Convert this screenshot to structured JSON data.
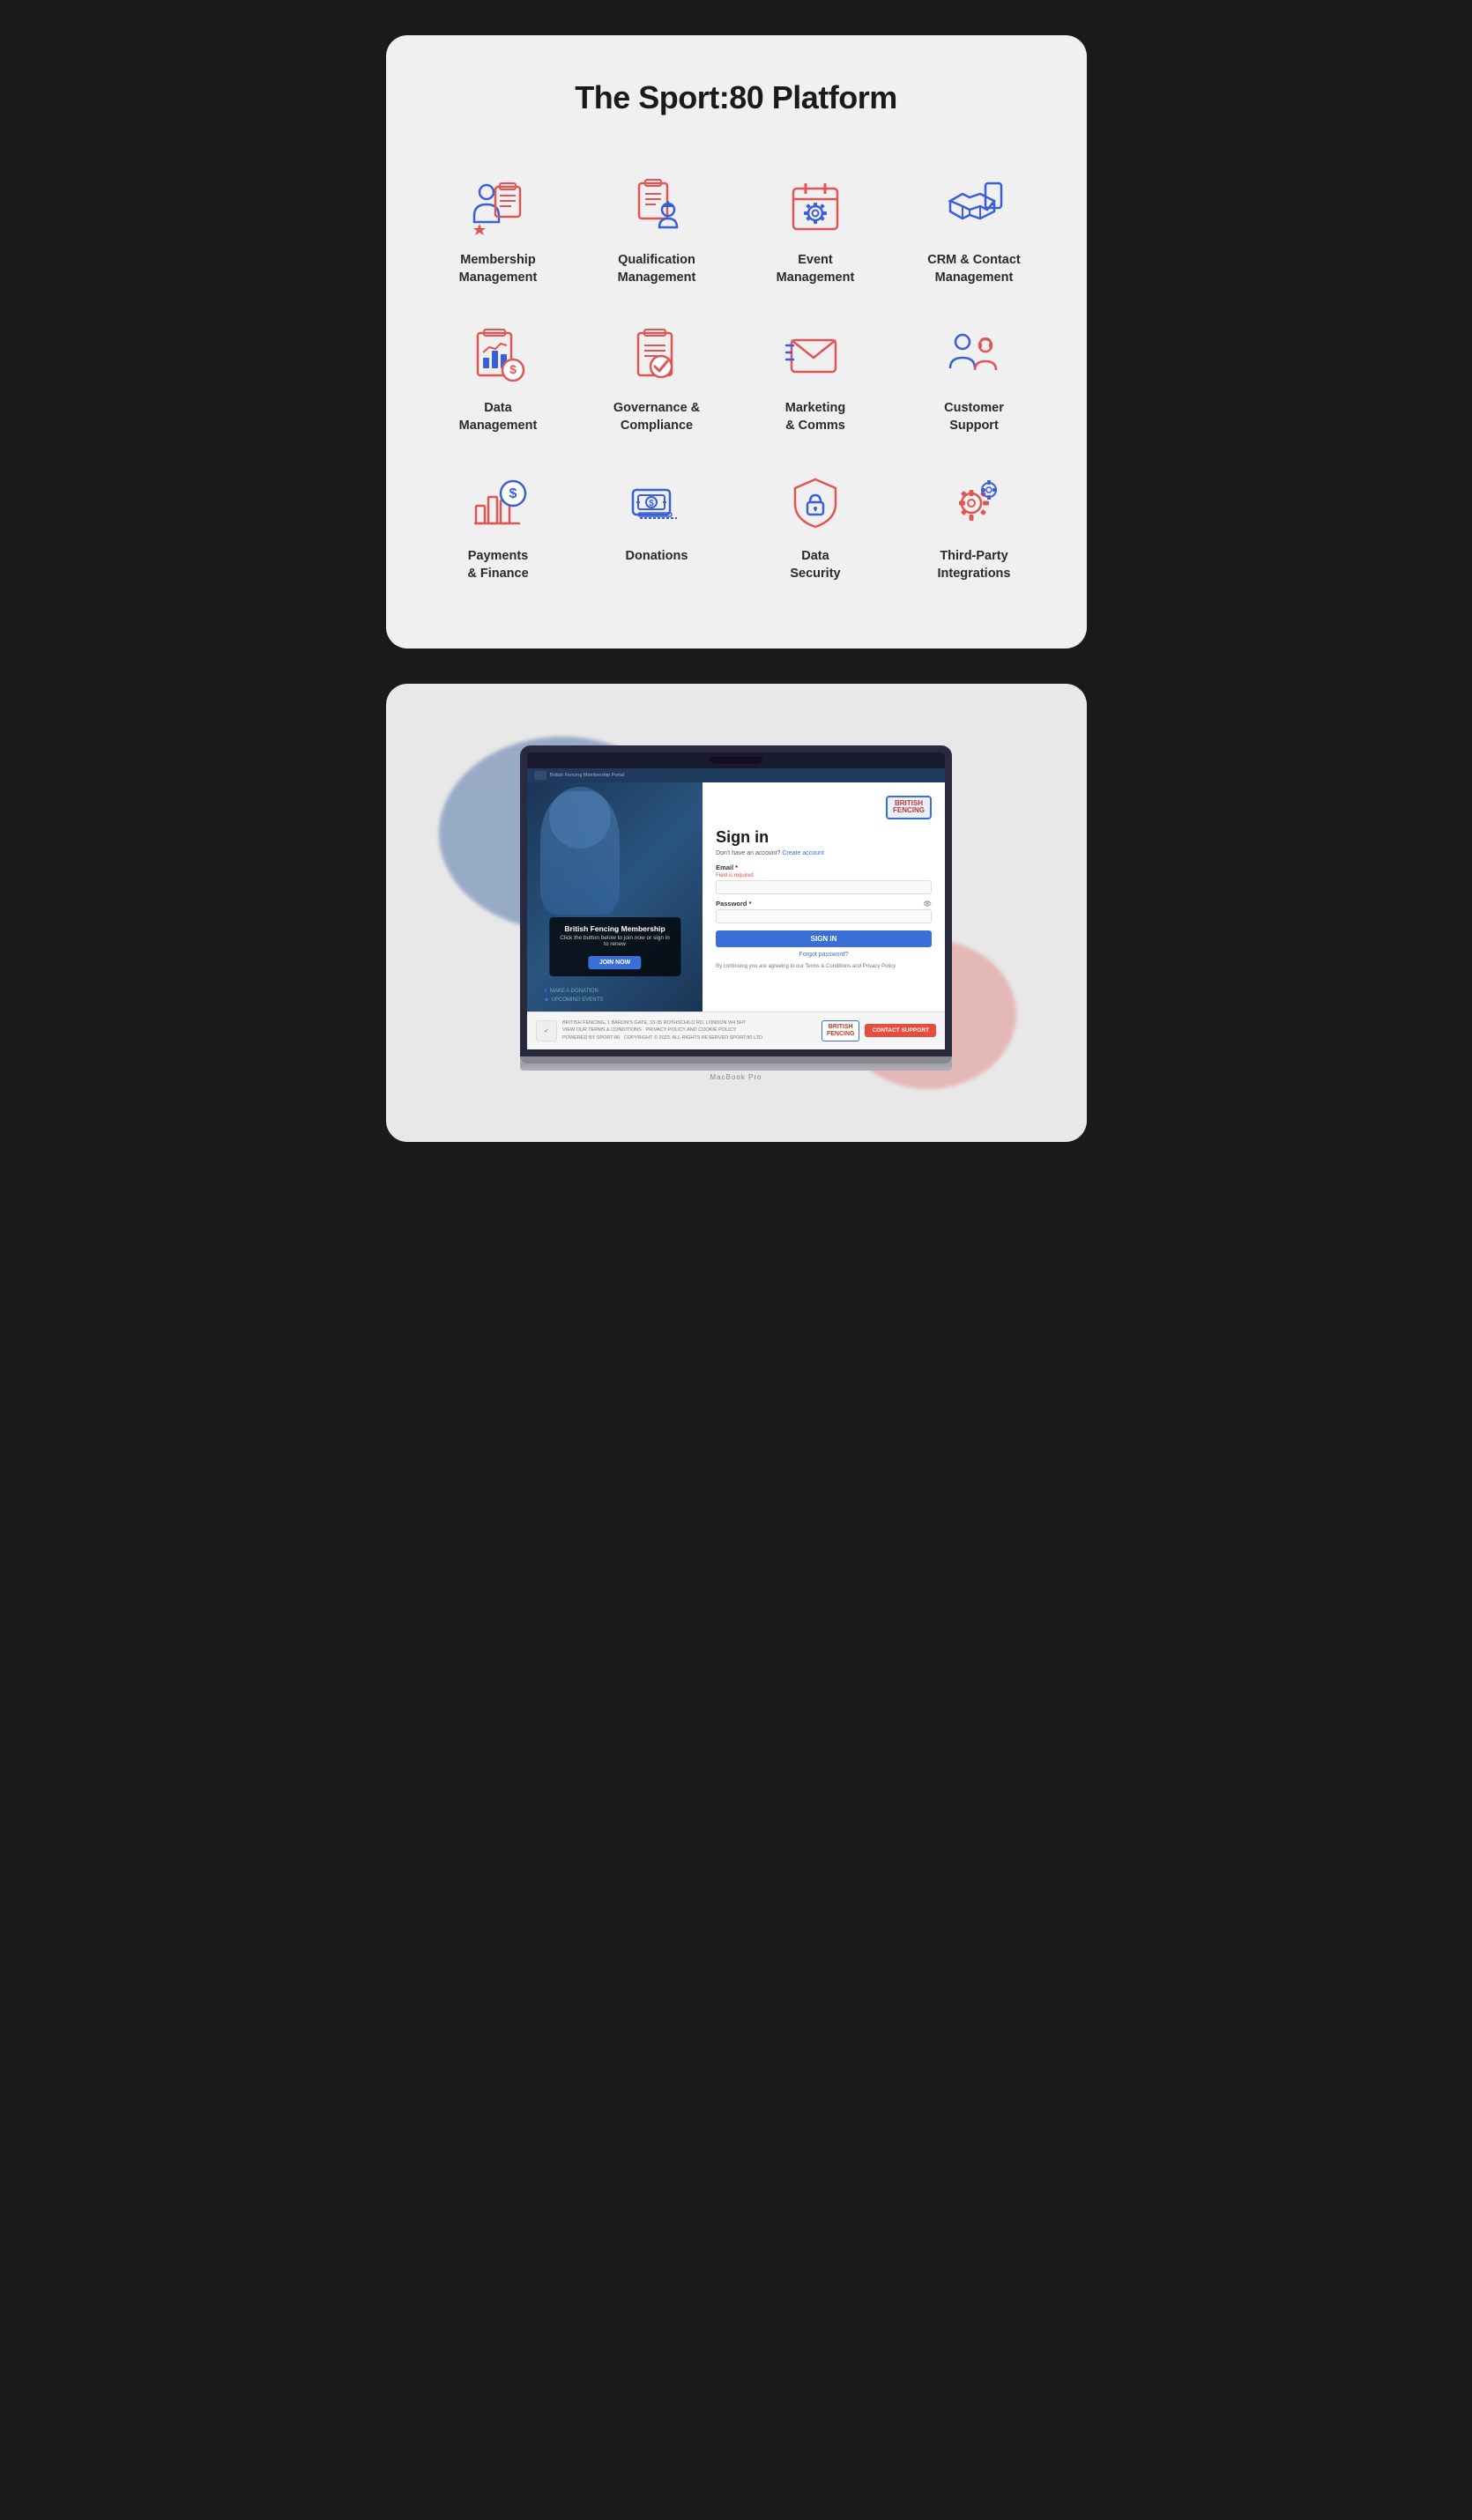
{
  "platform": {
    "title": "The Sport:80 Platform",
    "items": [
      {
        "id": "membership-management",
        "label": "Membership\nManagement",
        "icon": "membership"
      },
      {
        "id": "qualification-management",
        "label": "Qualification\nManagement",
        "icon": "qualification"
      },
      {
        "id": "event-management",
        "label": "Event\nManagement",
        "icon": "event"
      },
      {
        "id": "crm-contact",
        "label": "CRM & Contact\nManagement",
        "icon": "crm"
      },
      {
        "id": "data-management",
        "label": "Data\nManagement",
        "icon": "data"
      },
      {
        "id": "governance-compliance",
        "label": "Governance &\nCompliance",
        "icon": "governance"
      },
      {
        "id": "marketing-comms",
        "label": "Marketing\n& Comms",
        "icon": "marketing"
      },
      {
        "id": "customer-support",
        "label": "Customer\nSupport",
        "icon": "support"
      },
      {
        "id": "payments-finance",
        "label": "Payments\n& Finance",
        "icon": "payments"
      },
      {
        "id": "donations",
        "label": "Donations",
        "icon": "donations"
      },
      {
        "id": "data-security",
        "label": "Data\nSecurity",
        "icon": "security"
      },
      {
        "id": "third-party",
        "label": "Third-Party\nIntegrations",
        "icon": "integrations"
      }
    ]
  },
  "laptop": {
    "title": "MacBook Pro",
    "british_fencing": {
      "logo_text": "BRITISH\nFENCING",
      "signin_title": "Sign in",
      "create_account_text": "Don't have an account?",
      "create_account_link": "Create account",
      "email_label": "Email *",
      "email_error": "Field is required",
      "password_label": "Password *",
      "signin_button": "SIGN IN",
      "forgot_password": "Forgot password?",
      "terms_text": "By continuing you are agreeing to our Terms & Conditions and Privacy Policy",
      "membership_title": "British Fencing Membership",
      "membership_sub": "Click the button below to join now or sign in to renew",
      "join_button": "JOIN NOW",
      "make_donation": "MAKE A DONATION",
      "upcoming_events": "UPCOMING EVENTS",
      "footer_address": "BRITISH FENCING, 1 BARON'S GATE, 33-35 ROTHSCHILD RD, LONDON W4 5HT",
      "footer_terms": "VIEW OUR TERMS & CONDITIONS · PRIVACY POLICY AND COOKIE POLICY",
      "footer_powered": "POWERED BY SPORT-80",
      "footer_copyright": "COPYRIGHT © 2023. ALL RIGHTS RESERVED SPORT:80 LTD.",
      "footer_logo": "BRITISH\nFENCING",
      "contact_support": "CONTACT SUPPORT"
    }
  },
  "colors": {
    "primary_blue": "#3a6fd8",
    "red_accent": "#e05555",
    "blue_icon": "#3a5fd8",
    "red_icon": "#e05555",
    "dark_text": "#1a1a1a",
    "medium_text": "#555555"
  }
}
